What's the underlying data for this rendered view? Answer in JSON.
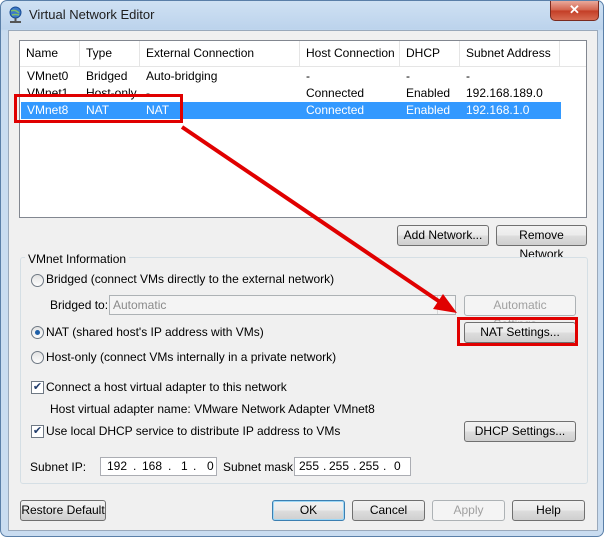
{
  "window": {
    "title": "Virtual Network Editor",
    "close_label": "✕"
  },
  "table": {
    "columns": [
      "Name",
      "Type",
      "External Connection",
      "Host Connection",
      "DHCP",
      "Subnet Address"
    ],
    "rows": [
      [
        "VMnet0",
        "Bridged",
        "Auto-bridging",
        "-",
        "-",
        "-"
      ],
      [
        "VMnet1",
        "Host-only",
        "-",
        "Connected",
        "Enabled",
        "192.168.189.0"
      ],
      [
        "VMnet8",
        "NAT",
        "NAT",
        "Connected",
        "Enabled",
        "192.168.1.0"
      ]
    ],
    "selected_row": 2
  },
  "buttons": {
    "add_network": "Add Network...",
    "remove_network": "Remove Network",
    "automatic_settings": "Automatic Settings...",
    "nat_settings": "NAT Settings...",
    "dhcp_settings": "DHCP Settings...",
    "restore_default": "Restore Default",
    "ok": "OK",
    "cancel": "Cancel",
    "apply": "Apply",
    "help": "Help"
  },
  "vmnet_info": {
    "group_label": "VMnet Information",
    "bridged_label": "Bridged (connect VMs directly to the external network)",
    "bridged_to_label": "Bridged to:",
    "bridged_to_value": "Automatic",
    "nat_label": "NAT (shared host's IP address with VMs)",
    "hostonly_label": "Host-only (connect VMs internally in a private network)",
    "selected_mode": "NAT",
    "connect_adapter_label": "Connect a host virtual adapter to this network",
    "connect_adapter_checked": true,
    "adapter_name_text": "Host virtual adapter name: VMware Network Adapter VMnet8",
    "dhcp_label": "Use local DHCP service to distribute IP address to VMs",
    "dhcp_checked": true,
    "subnet_ip_label": "Subnet IP:",
    "subnet_ip": [
      "192",
      "168",
      "1",
      "0"
    ],
    "subnet_mask_label": "Subnet mask:",
    "subnet_mask": [
      "255",
      "255",
      "255",
      "0"
    ]
  },
  "icons": {
    "app": "network-globe-icon",
    "check": "✔"
  },
  "colors": {
    "selection": "#3399ff",
    "annotation": "#e00000"
  }
}
